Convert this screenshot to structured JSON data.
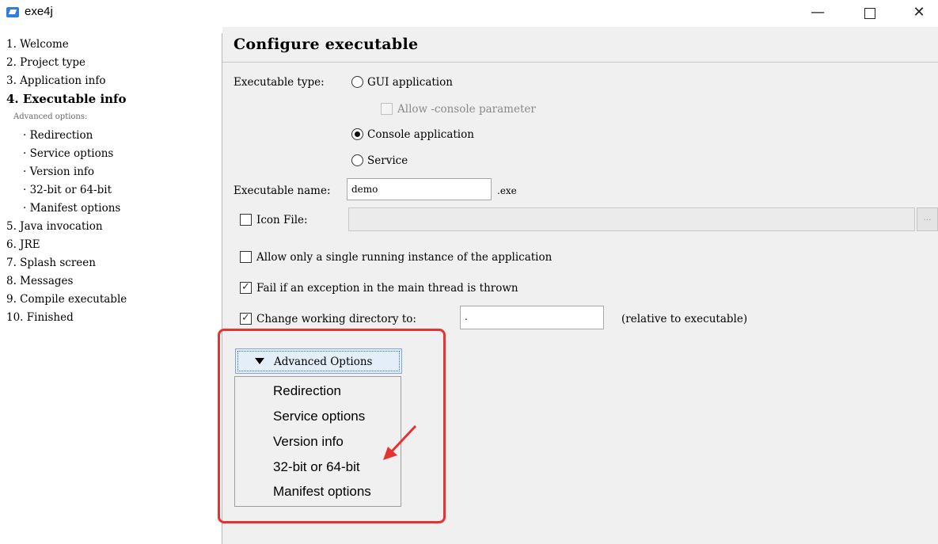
{
  "app": {
    "title": "exe4j"
  },
  "window_controls": {
    "minimize": "—",
    "maximize": "□",
    "close": "✕"
  },
  "sidebar": {
    "steps": [
      "1. Welcome",
      "2. Project type",
      "3. Application info",
      "4. Executable info"
    ],
    "advanced_caption": "Advanced options:",
    "sub_items": [
      "· Redirection",
      "· Service options",
      "· Version info",
      "· 32-bit or 64-bit",
      "· Manifest options"
    ],
    "steps_after": [
      "5. Java invocation",
      "6. JRE",
      "7. Splash screen",
      "8. Messages",
      "9. Compile executable",
      "10. Finished"
    ]
  },
  "main": {
    "heading": "Configure executable",
    "executable_type_label": "Executable type:",
    "gui_option": "GUI application",
    "allow_console_param": "Allow -console parameter",
    "console_option": "Console application",
    "service_option": "Service",
    "executable_name_label": "Executable name:",
    "executable_name_value": "demo",
    "exe_suffix": ".exe",
    "icon_file_label": "Icon File:",
    "icon_file_value": "",
    "browse_label": "...",
    "single_instance_label": "Allow only a single running instance of the application",
    "fail_exception_label": "Fail if an exception in the main thread is thrown",
    "change_dir_label": "Change working directory to:",
    "change_dir_value": ".",
    "relative_hint": "(relative to executable)",
    "advanced_button": "Advanced Options",
    "advanced_menu": [
      "Redirection",
      "Service options",
      "Version info",
      "32-bit or 64-bit",
      "Manifest options"
    ]
  },
  "state": {
    "gui_selected": false,
    "console_selected": true,
    "service_selected": false,
    "allow_console_checked": false,
    "icon_file_checked": false,
    "single_instance_checked": false,
    "fail_exception_checked": true,
    "change_dir_checked": true
  },
  "colors": {
    "highlight": "#e53333",
    "panel_background": "#f0f0f0",
    "button_background": "#e4eef9",
    "app_icon": "#2f7de1"
  },
  "icons": {
    "app": "exe4j-app-icon",
    "dropdown": "triangle-down-icon",
    "annotation": "red-arrow-icon"
  }
}
